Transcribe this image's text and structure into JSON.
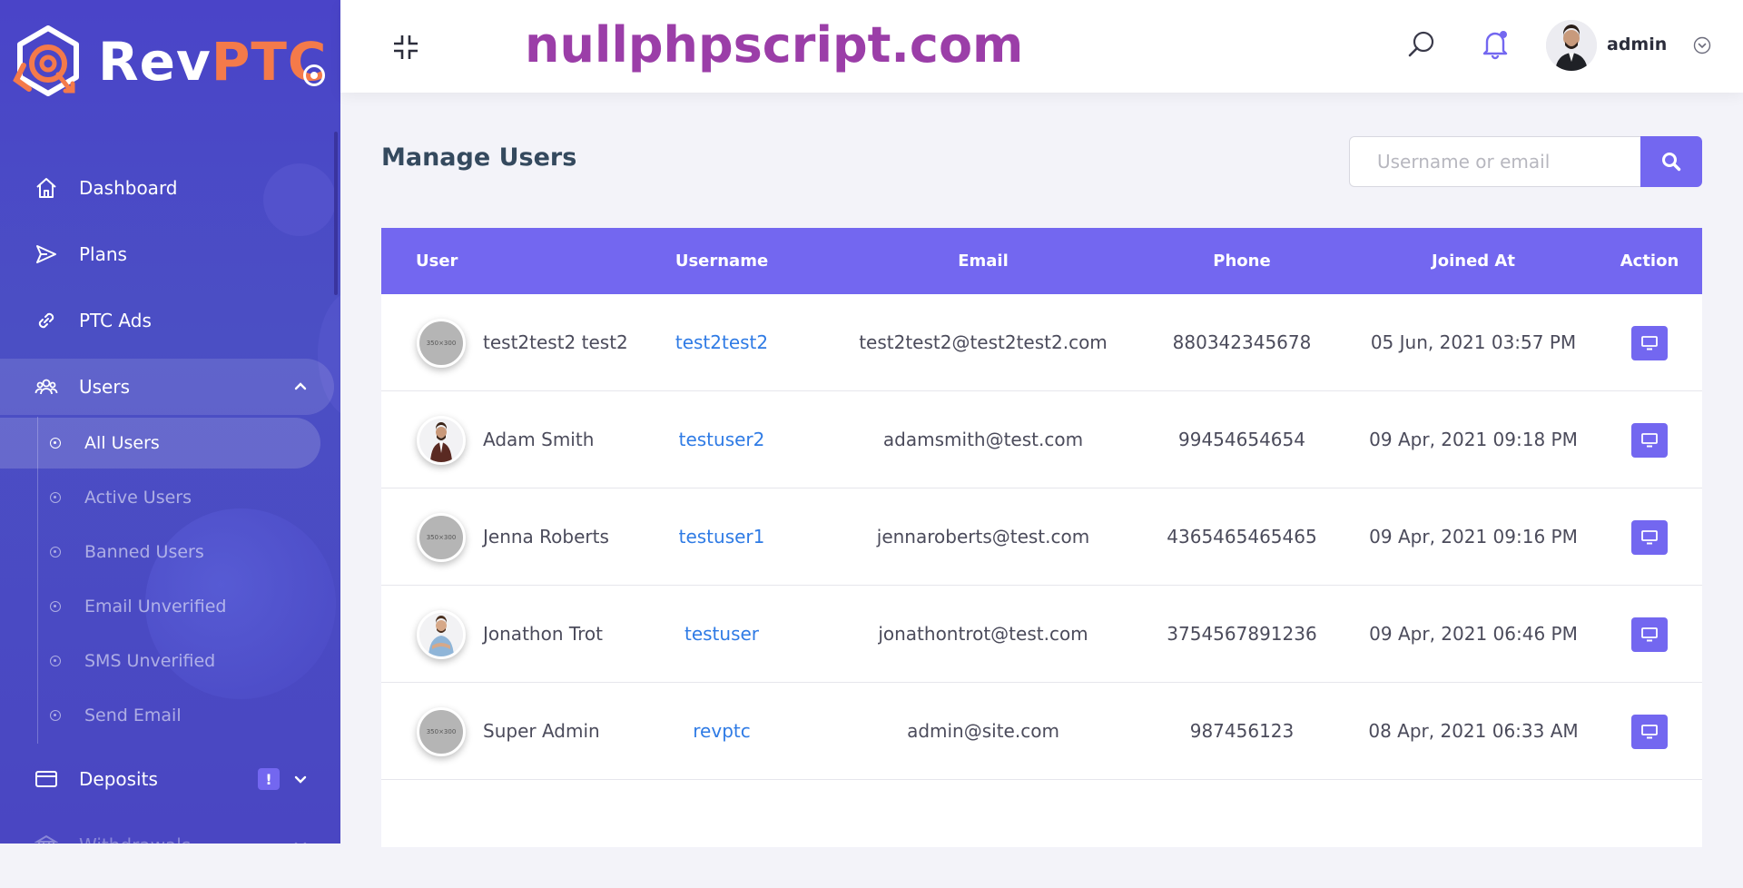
{
  "brand": {
    "name_rev": "Rev",
    "name_ptc": "PTC"
  },
  "header": {
    "watermark": "nullphpscript.com",
    "user_name": "admin"
  },
  "sidebar": {
    "items": [
      {
        "label": "Dashboard",
        "icon": "home-icon"
      },
      {
        "label": "Plans",
        "icon": "send-icon"
      },
      {
        "label": "PTC Ads",
        "icon": "link-icon"
      },
      {
        "label": "Users",
        "icon": "users-icon"
      }
    ],
    "users_sub": [
      {
        "label": "All Users"
      },
      {
        "label": "Active Users"
      },
      {
        "label": "Banned Users"
      },
      {
        "label": "Email Unverified"
      },
      {
        "label": "SMS Unverified"
      },
      {
        "label": "Send Email"
      }
    ],
    "deposits": {
      "label": "Deposits",
      "badge": "!"
    },
    "withdrawals": {
      "label": "Withdrawals"
    }
  },
  "page": {
    "title": "Manage Users"
  },
  "search": {
    "placeholder": "Username or email"
  },
  "table": {
    "columns": [
      "User",
      "Username",
      "Email",
      "Phone",
      "Joined At",
      "Action"
    ],
    "rows": [
      {
        "name": "test2test2 test2",
        "username": "test2test2",
        "email": "test2test2@test2test2.com",
        "phone": "880342345678",
        "joined": "05 Jun, 2021 03:57 PM",
        "avatar": "350×300"
      },
      {
        "name": "Adam Smith",
        "username": "testuser2",
        "email": "adamsmith@test.com",
        "phone": "99454654654",
        "joined": "09 Apr, 2021 09:18 PM",
        "avatar": ""
      },
      {
        "name": "Jenna Roberts",
        "username": "testuser1",
        "email": "jennaroberts@test.com",
        "phone": "4365465465465",
        "joined": "09 Apr, 2021 09:16 PM",
        "avatar": "350×300"
      },
      {
        "name": "Jonathon Trot",
        "username": "testuser",
        "email": "jonathontrot@test.com",
        "phone": "3754567891236",
        "joined": "09 Apr, 2021 06:46 PM",
        "avatar": ""
      },
      {
        "name": "Super Admin",
        "username": "revptc",
        "email": "admin@site.com",
        "phone": "987456123",
        "joined": "08 Apr, 2021 06:33 AM",
        "avatar": "350×300"
      }
    ]
  },
  "colors": {
    "primary": "#7367f0",
    "sidebar": "#4a46c4",
    "accent_orange": "#f47a4a",
    "link": "#2f7be5",
    "watermark": "#9b3ea8"
  }
}
